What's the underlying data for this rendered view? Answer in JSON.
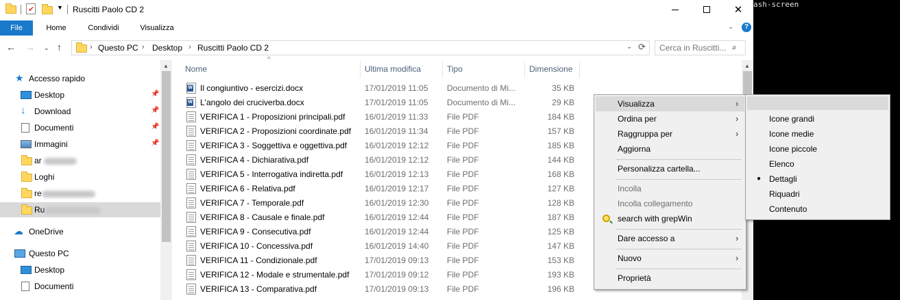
{
  "terminal": {
    "text": "ash-screen"
  },
  "window": {
    "title": "Ruscitti Paolo CD 2"
  },
  "ribbon": {
    "tabs": [
      "File",
      "Home",
      "Condividi",
      "Visualizza"
    ]
  },
  "address": {
    "segments": [
      "Questo PC",
      "Desktop",
      "Ruscitti Paolo CD 2"
    ]
  },
  "search": {
    "placeholder": "Cerca in Ruscitti..."
  },
  "nav": {
    "quick_access": "Accesso rapido",
    "items": [
      "Desktop",
      "Download",
      "Documenti",
      "Immagini",
      "ar",
      "Loghi",
      "re",
      "Ru"
    ],
    "onedrive": "OneDrive",
    "this_pc": "Questo PC",
    "pc_items": [
      "Desktop",
      "Documenti"
    ]
  },
  "columns": [
    "Nome",
    "Ultima modifica",
    "Tipo",
    "Dimensione"
  ],
  "files": [
    {
      "name": "Il congiuntivo - esercizi.docx",
      "date": "17/01/2019 11:05",
      "type": "Documento di Mi...",
      "size": "35 KB",
      "kind": "word"
    },
    {
      "name": "L'angolo dei cruciverba.docx",
      "date": "17/01/2019 11:05",
      "type": "Documento di Mi...",
      "size": "29 KB",
      "kind": "word"
    },
    {
      "name": "VERIFICA 1 - Proposizioni principali.pdf",
      "date": "16/01/2019 11:33",
      "type": "File PDF",
      "size": "184 KB",
      "kind": "pdf"
    },
    {
      "name": "VERIFICA 2 - Proposizioni coordinate.pdf",
      "date": "16/01/2019 11:34",
      "type": "File PDF",
      "size": "157 KB",
      "kind": "pdf"
    },
    {
      "name": "VERIFICA 3 - Soggettiva e oggettiva.pdf",
      "date": "16/01/2019 12:12",
      "type": "File PDF",
      "size": "185 KB",
      "kind": "pdf"
    },
    {
      "name": "VERIFICA 4 - Dichiarativa.pdf",
      "date": "16/01/2019 12:12",
      "type": "File PDF",
      "size": "144 KB",
      "kind": "pdf"
    },
    {
      "name": "VERIFICA 5 - Interrogativa indiretta.pdf",
      "date": "16/01/2019 12:13",
      "type": "File PDF",
      "size": "168 KB",
      "kind": "pdf"
    },
    {
      "name": "VERIFICA 6 - Relativa.pdf",
      "date": "16/01/2019 12:17",
      "type": "File PDF",
      "size": "127 KB",
      "kind": "pdf"
    },
    {
      "name": "VERIFICA 7 - Temporale.pdf",
      "date": "16/01/2019 12:30",
      "type": "File PDF",
      "size": "128 KB",
      "kind": "pdf"
    },
    {
      "name": "VERIFICA 8 - Causale e finale.pdf",
      "date": "16/01/2019 12:44",
      "type": "File PDF",
      "size": "187 KB",
      "kind": "pdf"
    },
    {
      "name": "VERIFICA 9 - Consecutiva.pdf",
      "date": "16/01/2019 12:44",
      "type": "File PDF",
      "size": "125 KB",
      "kind": "pdf"
    },
    {
      "name": "VERIFICA 10 - Concessiva.pdf",
      "date": "16/01/2019 14:40",
      "type": "File PDF",
      "size": "147 KB",
      "kind": "pdf"
    },
    {
      "name": "VERIFICA 11 - Condizionale.pdf",
      "date": "17/01/2019 09:13",
      "type": "File PDF",
      "size": "153 KB",
      "kind": "pdf"
    },
    {
      "name": "VERIFICA 12 - Modale e strumentale.pdf",
      "date": "17/01/2019 09:12",
      "type": "File PDF",
      "size": "193 KB",
      "kind": "pdf"
    },
    {
      "name": "VERIFICA 13 - Comparativa.pdf",
      "date": "17/01/2019 09:13",
      "type": "File PDF",
      "size": "196 KB",
      "kind": "pdf"
    }
  ],
  "context_menu": {
    "visualizza": "Visualizza",
    "ordina": "Ordina per",
    "raggruppa": "Raggruppa per",
    "aggiorna": "Aggiorna",
    "personalizza": "Personalizza cartella...",
    "incolla": "Incolla",
    "incolla_collegamento": "Incolla collegamento",
    "grepwin": "search with grepWin",
    "dare_accesso": "Dare accesso a",
    "nuovo": "Nuovo",
    "proprieta": "Proprietà"
  },
  "view_submenu": {
    "items": [
      "Icone grandi",
      "Icone medie",
      "Icone piccole",
      "Elenco",
      "Dettagli",
      "Riquadri",
      "Contenuto"
    ],
    "selected": "Dettagli"
  },
  "colors": {
    "accent": "#1979ca",
    "selection": "#d9d9d9",
    "menu_bg": "#f0f0f0"
  }
}
